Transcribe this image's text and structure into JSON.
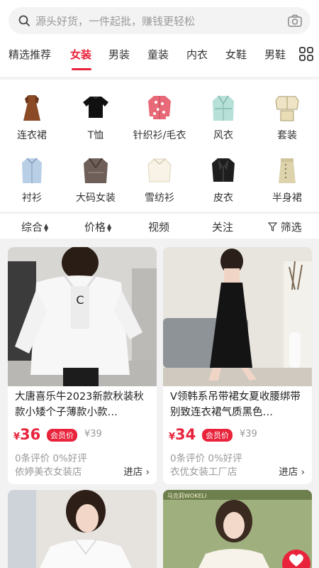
{
  "search": {
    "placeholder": "源头好货，一件起批，赚钱更轻松",
    "icon": "search-icon",
    "camera_icon": "camera-icon"
  },
  "tabs": [
    "精选推荐",
    "女装",
    "男装",
    "童装",
    "内衣",
    "女鞋",
    "男鞋"
  ],
  "active_tab": "女装",
  "accent_color": "#e8233b",
  "categories": [
    {
      "label": "连衣裙",
      "icon": "dress-thumbnail"
    },
    {
      "label": "T恤",
      "icon": "tshirt-thumbnail"
    },
    {
      "label": "针织衫/毛衣",
      "icon": "cardigan-thumbnail"
    },
    {
      "label": "风衣",
      "icon": "trenchcoat-thumbnail"
    },
    {
      "label": "套装",
      "icon": "suit-set-thumbnail"
    },
    {
      "label": "衬衫",
      "icon": "shirt-thumbnail"
    },
    {
      "label": "大码女装",
      "icon": "plus-size-thumbnail"
    },
    {
      "label": "雪纺衫",
      "icon": "chiffon-thumbnail"
    },
    {
      "label": "皮衣",
      "icon": "leather-jacket-thumbnail"
    },
    {
      "label": "半身裙",
      "icon": "skirt-thumbnail"
    }
  ],
  "sort": {
    "comprehensive": "综合",
    "price": "价格",
    "video": "视频",
    "follow": "关注",
    "filter": "筛选"
  },
  "products": [
    {
      "title": "大唐喜乐牛2023新款秋装秋款小矮个子薄款小款…",
      "price_symbol": "¥",
      "price": "36",
      "member_tag": "会员价",
      "orig_price": "¥39",
      "reviews": "0条评价  0%好评",
      "shop": "依婷美衣女装店",
      "enter": "进店 ›"
    },
    {
      "title": "V领韩系吊带裙女夏收腰绑带别致连衣裙气质黑色…",
      "price_symbol": "¥",
      "price": "34",
      "member_tag": "会员价",
      "orig_price": "¥39",
      "reviews": "0条评价  0%好评",
      "shop": "衣优女装工厂店",
      "enter": "进店 ›"
    }
  ]
}
